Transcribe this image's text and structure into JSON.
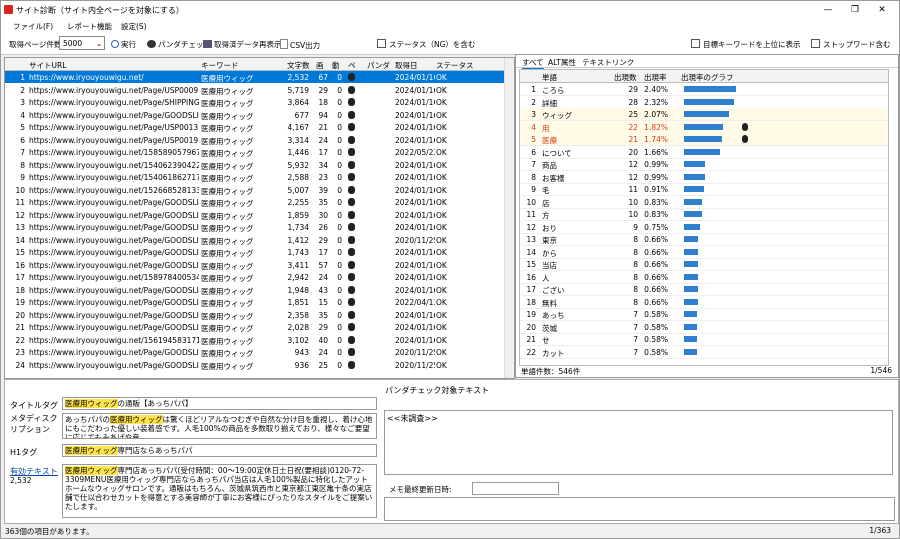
{
  "window": {
    "title": "サイト診断（サイト内全ページを対象にする）",
    "min": "—",
    "max": "❐",
    "close": "✕"
  },
  "menu": [
    "ファイル(F)",
    "レポート機能",
    "設定(S)"
  ],
  "toolbar": {
    "pages_label": "取得ページ件数",
    "pages_value": "5000",
    "run": "実行",
    "panda": "パンダチェック",
    "reload": "取得済データ再表示",
    "csv": "CSV出力",
    "status_ng": "ステータス（NG）を含む",
    "target_top": "目標キーワードを上位に表示",
    "stopword": "ストップワード含む"
  },
  "left_table": {
    "headers": [
      "サイトURL",
      "キーワード",
      "文字数",
      "画",
      "動",
      "ペ",
      "パンダ",
      "取得日",
      "ステータス"
    ],
    "rows": [
      [
        "1",
        "https://www.iryouyouwigu.net/",
        "医療用ウィッグ",
        "2,532",
        "67",
        "0",
        "2024/01/16",
        "OK"
      ],
      [
        "2",
        "https://www.iryouyouwigu.net/Page/USP0009",
        "医療用ウィッグ",
        "5,719",
        "29",
        "0",
        "2024/01/16",
        "OK"
      ],
      [
        "3",
        "https://www.iryouyouwigu.net/Page/SHIPPING_INFO",
        "医療用ウィッグ",
        "3,864",
        "18",
        "0",
        "2024/01/16",
        "OK"
      ],
      [
        "4",
        "https://www.iryouyouwigu.net/Page/GOODSLIST",
        "医療用ウィッグ",
        "677",
        "94",
        "0",
        "2024/01/16",
        "OK"
      ],
      [
        "5",
        "https://www.iryouyouwigu.net/Page/USP0013",
        "医療用ウィッグ",
        "4,167",
        "21",
        "0",
        "2024/01/16",
        "OK"
      ],
      [
        "6",
        "https://www.iryouyouwigu.net/Page/USP0019",
        "医療用ウィッグ",
        "3,314",
        "24",
        "0",
        "2024/01/16",
        "OK"
      ],
      [
        "7",
        "https://www.iryouyouwigu.net/15858905796784",
        "医療用ウィッグ",
        "1,446",
        "17",
        "0",
        "2022/05/23",
        "OK"
      ],
      [
        "8",
        "https://www.iryouyouwigu.net/15406239042222",
        "医療用ウィッグ",
        "5,932",
        "34",
        "0",
        "2024/01/16",
        "OK"
      ],
      [
        "9",
        "https://www.iryouyouwigu.net/15406186271790",
        "医療用ウィッグ",
        "2,588",
        "23",
        "0",
        "2024/01/16",
        "OK"
      ],
      [
        "10",
        "https://www.iryouyouwigu.net/15266852813362",
        "医療用ウィッグ",
        "5,007",
        "39",
        "0",
        "2024/01/16",
        "OK"
      ],
      [
        "11",
        "https://www.iryouyouwigu.net/Page/GOODSLIST-46",
        "医療用ウィッグ",
        "2,255",
        "35",
        "0",
        "2024/01/16",
        "OK"
      ],
      [
        "12",
        "https://www.iryouyouwigu.net/Page/GOODSLIST-15",
        "医療用ウィッグ",
        "1,859",
        "30",
        "0",
        "2024/01/16",
        "OK"
      ],
      [
        "13",
        "https://www.iryouyouwigu.net/Page/GOODSLIST-37",
        "医療用ウィッグ",
        "1,734",
        "26",
        "0",
        "2024/01/16",
        "OK"
      ],
      [
        "14",
        "https://www.iryouyouwigu.net/Page/GOODSLIST-22",
        "医療用ウィッグ",
        "1,412",
        "29",
        "0",
        "2020/11/25",
        "OK"
      ],
      [
        "15",
        "https://www.iryouyouwigu.net/Page/GOODSLIST-55",
        "医療用ウィッグ",
        "1,743",
        "17",
        "0",
        "2024/01/16",
        "OK"
      ],
      [
        "16",
        "https://www.iryouyouwigu.net/Page/GOODSLIST-34",
        "医療用ウィッグ",
        "3,411",
        "57",
        "0",
        "2024/01/16",
        "OK"
      ],
      [
        "17",
        "https://www.iryouyouwigu.net/15897840053483",
        "医療用ウィッグ",
        "2,942",
        "24",
        "0",
        "2024/01/16",
        "OK"
      ],
      [
        "18",
        "https://www.iryouyouwigu.net/Page/GOODSLIST-58",
        "医療用ウィッグ",
        "1,948",
        "43",
        "0",
        "2024/01/16",
        "OK"
      ],
      [
        "19",
        "https://www.iryouyouwigu.net/Page/GOODSLIST-61",
        "医療用ウィッグ",
        "1,851",
        "15",
        "0",
        "2022/04/13",
        "OK"
      ],
      [
        "20",
        "https://www.iryouyouwigu.net/Page/GOODSLIST-1",
        "医療用ウィッグ",
        "2,358",
        "35",
        "0",
        "2024/01/16",
        "OK"
      ],
      [
        "21",
        "https://www.iryouyouwigu.net/Page/GOODSLIST-2",
        "医療用ウィッグ",
        "2,028",
        "29",
        "0",
        "2024/01/16",
        "OK"
      ],
      [
        "22",
        "https://www.iryouyouwigu.net/15619458317124",
        "医療用ウィッグ",
        "3,102",
        "40",
        "0",
        "2024/01/16",
        "OK"
      ],
      [
        "23",
        "https://www.iryouyouwigu.net/Page/GOODSLIST-45",
        "医療用ウィッグ",
        "943",
        "24",
        "0",
        "2020/11/25",
        "OK"
      ],
      [
        "24",
        "https://www.iryouyouwigu.net/Page/GOODSLIST-92",
        "医療用ウィッグ",
        "936",
        "25",
        "0",
        "2020/11/25",
        "OK"
      ]
    ]
  },
  "right_panel": {
    "tabs": [
      "すべて",
      "ALT属性",
      "テキストリンク"
    ],
    "headers": [
      "単語",
      "出現数",
      "出現率",
      "出現率のグラフ"
    ],
    "rows": [
      [
        "1",
        "ころら",
        "29",
        "2.40%"
      ],
      [
        "2",
        "詳細",
        "28",
        "2.32%"
      ],
      [
        "3",
        "ウィッグ",
        "25",
        "2.07%"
      ],
      [
        "4",
        "用",
        "22",
        "1.82%"
      ],
      [
        "5",
        "医療",
        "21",
        "1.74%"
      ],
      [
        "6",
        "について",
        "20",
        "1.66%"
      ],
      [
        "7",
        "商品",
        "12",
        "0.99%"
      ],
      [
        "8",
        "お客様",
        "12",
        "0.99%"
      ],
      [
        "9",
        "毛",
        "11",
        "0.91%"
      ],
      [
        "10",
        "店",
        "10",
        "0.83%"
      ],
      [
        "11",
        "方",
        "10",
        "0.83%"
      ],
      [
        "12",
        "おり",
        "9",
        "0.75%"
      ],
      [
        "13",
        "東京",
        "8",
        "0.66%"
      ],
      [
        "14",
        "から",
        "8",
        "0.66%"
      ],
      [
        "15",
        "当店",
        "8",
        "0.66%"
      ],
      [
        "16",
        "人",
        "8",
        "0.66%"
      ],
      [
        "17",
        "ござい",
        "8",
        "0.66%"
      ],
      [
        "18",
        "無料",
        "8",
        "0.66%"
      ],
      [
        "19",
        "あっち",
        "7",
        "0.58%"
      ],
      [
        "20",
        "茨城",
        "7",
        "0.58%"
      ],
      [
        "21",
        "せ",
        "7",
        "0.58%"
      ],
      [
        "22",
        "カット",
        "7",
        "0.58%"
      ]
    ],
    "word_count": "単語件数：546件",
    "page": "1/546"
  },
  "details": {
    "title_label": "タイトルタグ",
    "title_hl": "医療用ウィッグ",
    "title_rest": "の通販【あっちパパ】",
    "meta_label": "メタディスクリプション",
    "meta_pre": "あっちパパの",
    "meta_hl": "医療用ウィッグ",
    "meta_rest": "は驚くほどリアルなつむぎや自然な分け目を重視し、着け心地にもこだわった優しい装着感です。人毛100%の商品を多数取り揃えており、様々なご要望に応じてもみあげや産",
    "h1_label": "H1タグ",
    "h1_hl": "医療用ウィッグ",
    "h1_rest": "専門店ならあっちパパ",
    "body_label": "有効テキスト",
    "body_count": "2,532",
    "body_hl": "医療用ウィッグ",
    "body_rest": "専門店あっちパパ(受付時間：00〜19:00定休日土日祝(要相談)0120-72-3309MENU医療用ウィッグ専門店ならあっちパパ当店は人毛100%製品に特化したアットホームなウィッグサロンです。通販はもちろん、茨城県筑西市と東京都江東区亀十条の実店舗で仕以合わせカットを得意とする美容師が丁寧にお客様にぴったりなスタイルをご提案いたします。",
    "panda_label": "パンダチェック対象テキスト",
    "panda_text": "<<未調査>>",
    "meta_date_label": "メモ最終更新日時:",
    "page": "1/363"
  },
  "status": "363個の項目があります。"
}
